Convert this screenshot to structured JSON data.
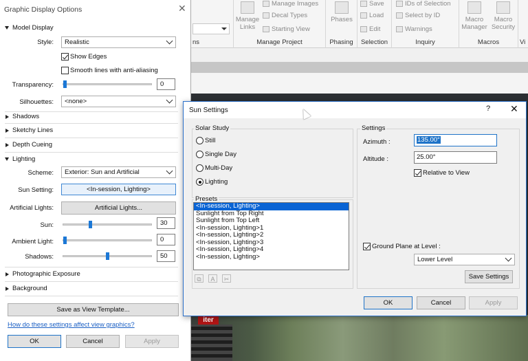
{
  "ribbon": {
    "groups": [
      {
        "title": "ns"
      },
      {
        "title": "Manage Project"
      },
      {
        "title": "Phasing"
      },
      {
        "title": "Selection"
      },
      {
        "title": "Inquiry"
      },
      {
        "title": "Macros"
      },
      {
        "title": "Vi"
      }
    ],
    "manage_links": "Manage\nLinks",
    "manage_images": "Manage Images",
    "decal_types": "Decal Types",
    "starting_view": "Starting View",
    "phases": "Phases",
    "save": "Save",
    "load": "Load",
    "edit": "Edit",
    "ids_of_selection": "IDs of Selection",
    "select_by_id": "Select by ID",
    "warnings": "Warnings",
    "macro_manager": "Macro\nManager",
    "macro_security": "Macro\nSecurity"
  },
  "gdo": {
    "title": "Graphic Display Options",
    "sections": {
      "model_display": "Model Display",
      "shadows": "Shadows",
      "sketchy_lines": "Sketchy Lines",
      "depth_cueing": "Depth Cueing",
      "lighting": "Lighting",
      "photographic_exposure": "Photographic Exposure",
      "background": "Background"
    },
    "style_label": "Style:",
    "style_value": "Realistic",
    "show_edges": "Show Edges",
    "smooth_lines": "Smooth lines with anti-aliasing",
    "transparency_label": "Transparency:",
    "transparency_value": "0",
    "silhouettes_label": "Silhouettes:",
    "silhouettes_value": "<none>",
    "scheme_label": "Scheme:",
    "scheme_value": "Exterior: Sun and Artificial",
    "sun_setting_label": "Sun Setting:",
    "sun_setting_value": "<In-session, Lighting>",
    "artificial_lights_label": "Artificial Lights:",
    "artificial_lights_button": "Artificial Lights...",
    "sun_label": "Sun:",
    "sun_value": "30",
    "ambient_light_label": "Ambient Light:",
    "ambient_light_value": "0",
    "shadows_label": "Shadows:",
    "shadows_value": "50",
    "save_template": "Save as View Template...",
    "help_link": "How do these settings affect view graphics?",
    "ok": "OK",
    "cancel": "Cancel",
    "apply": "Apply",
    "slider_levels": {
      "transparency": 0,
      "sun": 30,
      "ambient": 0,
      "shadows": 50
    }
  },
  "sun": {
    "title": "Sun Settings",
    "help": "?",
    "solar_study_label": "Solar Study",
    "options": [
      "Still",
      "Single Day",
      "Multi-Day",
      "Lighting"
    ],
    "selected_option": "Lighting",
    "presets_label": "Presets",
    "presets": [
      "<In-session, Lighting>",
      "Sunlight from Top Right",
      "Sunlight from Top Left",
      "<In-session, Lighting>1",
      "<In-session, Lighting>2",
      "<In-session, Lighting>3",
      "<In-session, Lighting>4",
      "<In-session, Lighting>"
    ],
    "settings_label": "Settings",
    "azimuth_label": "Azimuth :",
    "azimuth_value": "135.00°",
    "altitude_label": "Altitude :",
    "altitude_value": "25.00°",
    "relative_to_view": "Relative to View",
    "ground_plane": "Ground Plane at Level :",
    "level_value": "Lower Level",
    "save_settings": "Save Settings",
    "ok": "OK",
    "cancel": "Cancel",
    "apply": "Apply"
  },
  "viewport": {
    "sign_text": "iter"
  }
}
